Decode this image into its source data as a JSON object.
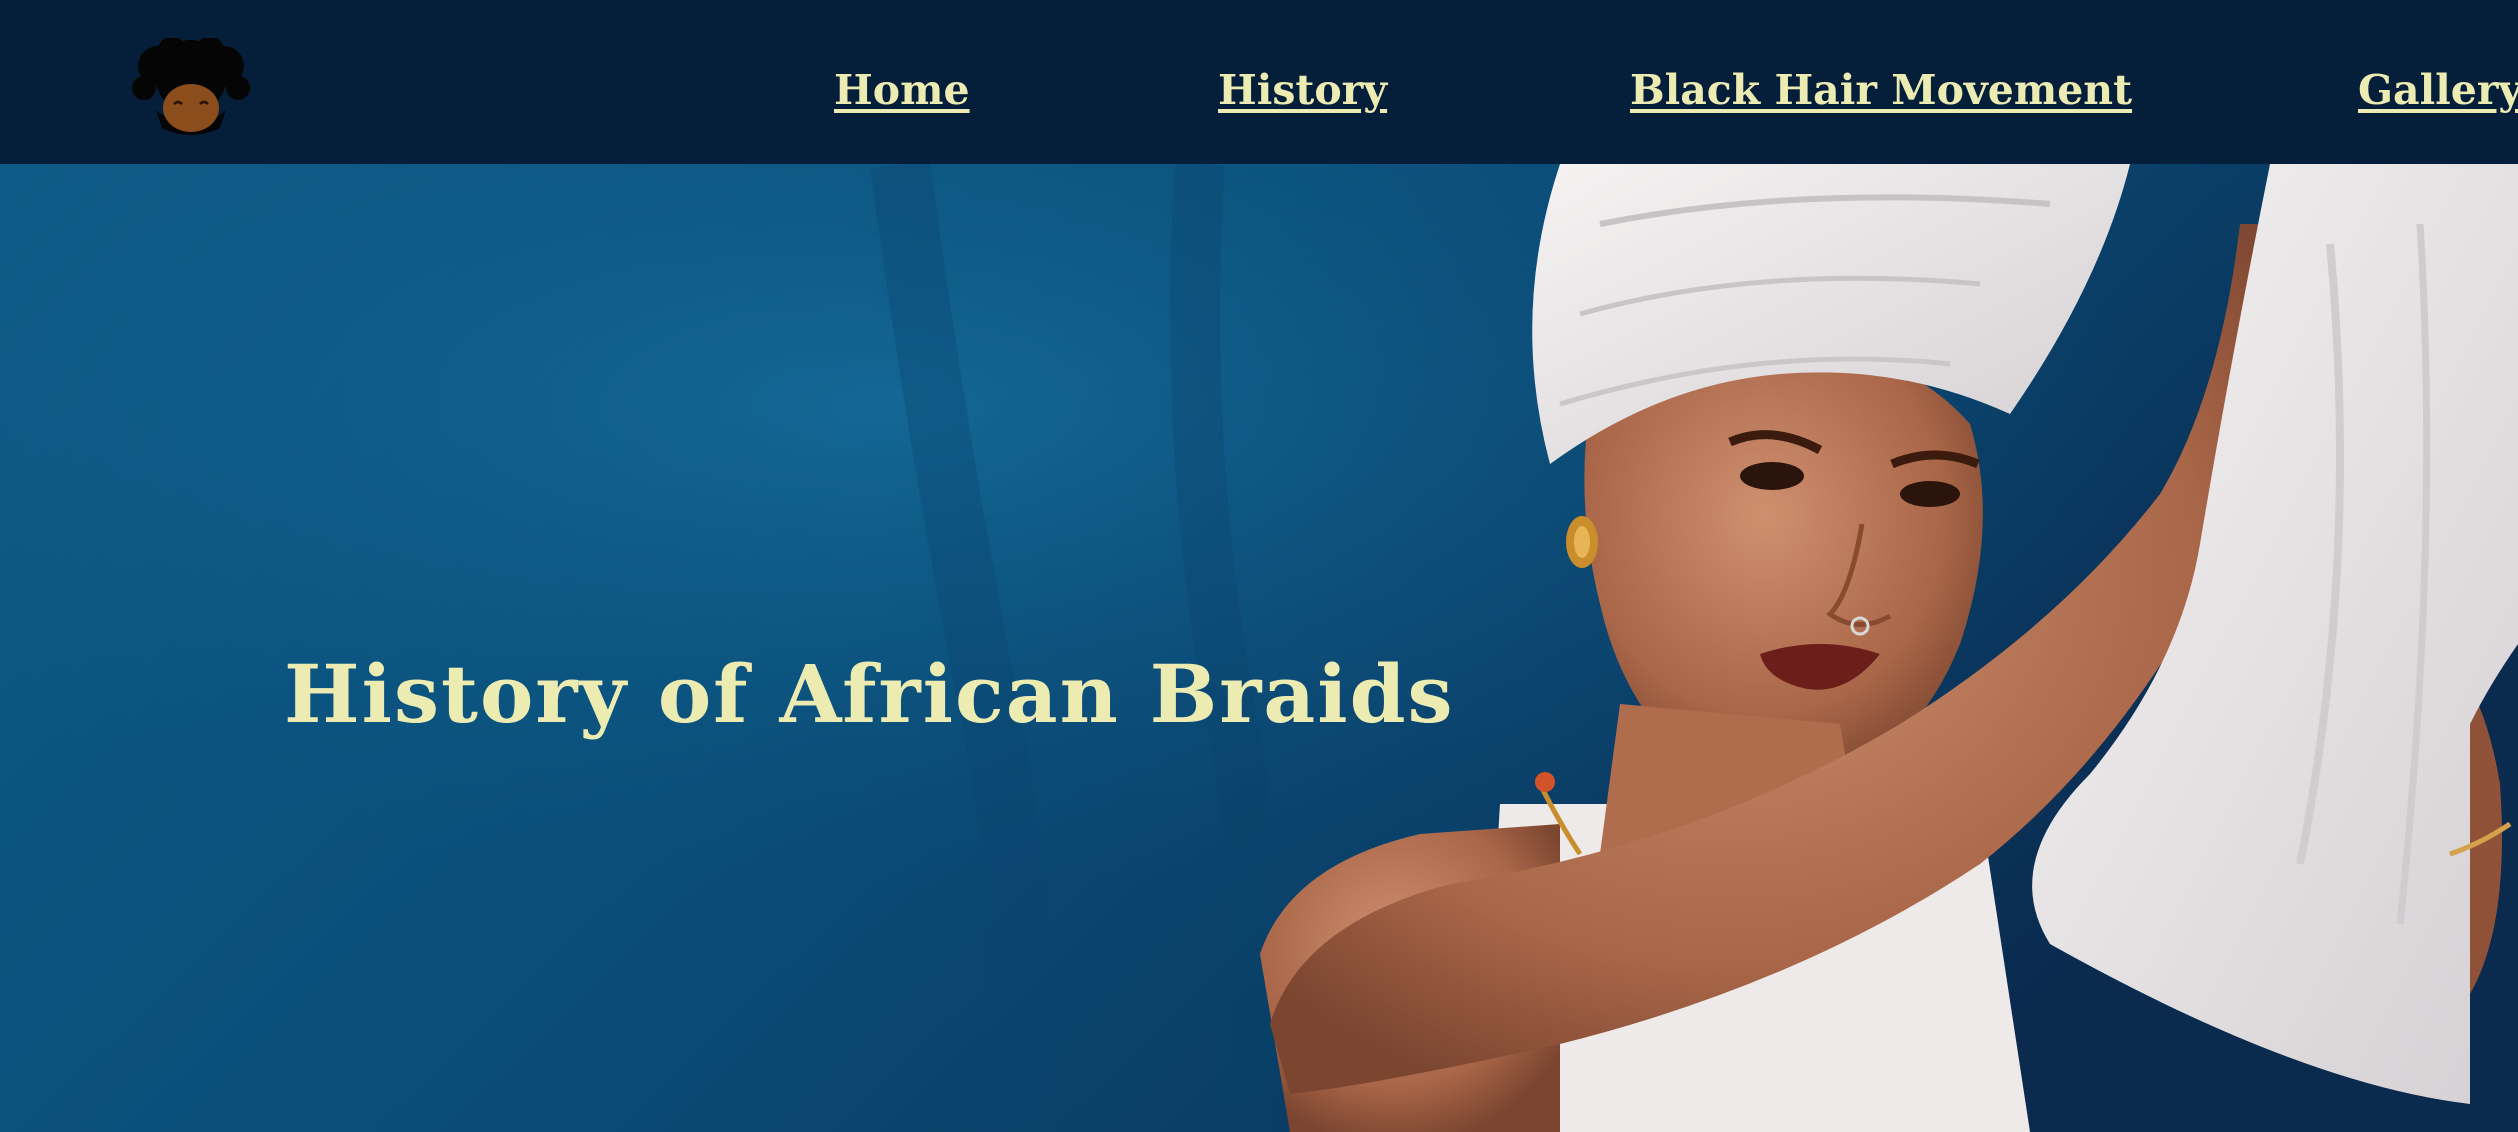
{
  "header": {
    "logo_icon": "afro-hair-woman-icon",
    "nav": [
      {
        "label": "Home"
      },
      {
        "label": "History"
      },
      {
        "label": "Black Hair Movement"
      },
      {
        "label": "Gallery"
      }
    ]
  },
  "hero": {
    "title": "History of African Braids",
    "image_icon": "woman-with-white-headwrap-photo"
  },
  "colors": {
    "navbar_bg": "#051f3a",
    "accent_text": "#ecebb2",
    "hero_bg": "#0d5480"
  }
}
